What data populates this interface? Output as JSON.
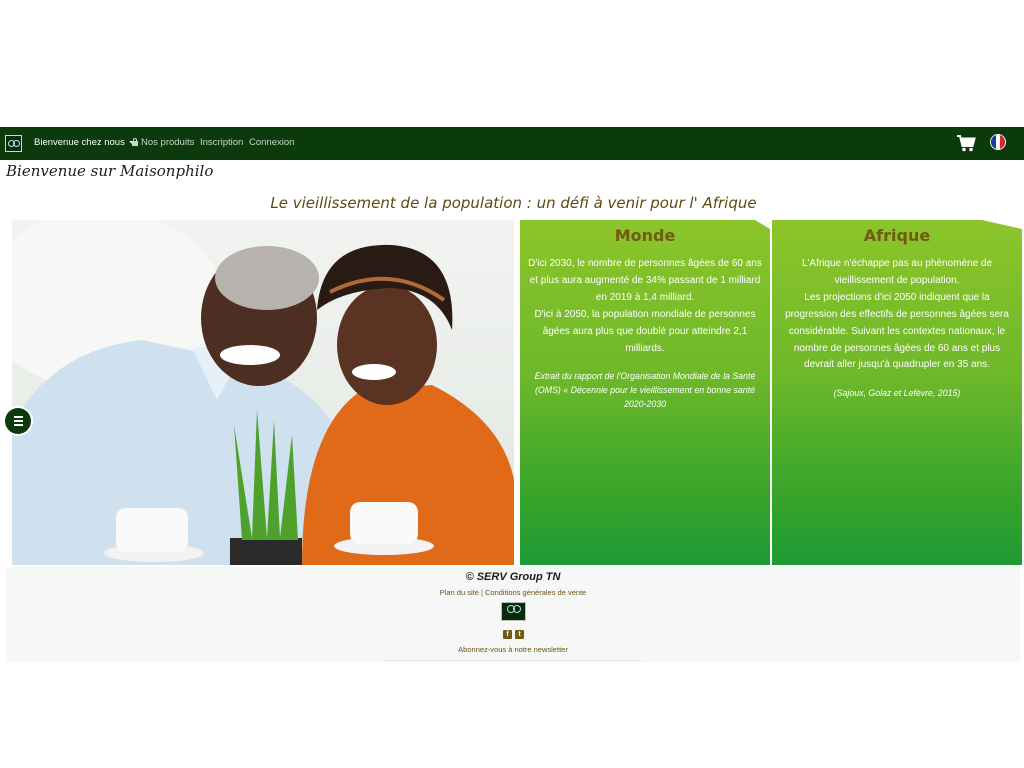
{
  "navbar": {
    "items": [
      {
        "label": "Bienvenue chez nous"
      },
      {
        "label": "Nos produits"
      },
      {
        "label": "Inscription"
      },
      {
        "label": "Connexion"
      }
    ],
    "icons": [
      "logo",
      "lock-icon",
      "cart-icon",
      "flag-fr-icon"
    ],
    "colors": {
      "background": "#0b3a0d",
      "accent": "#735a12"
    }
  },
  "welcome": "Bienvenue sur Maisonphilo",
  "headline": "Le vieillissement de la population : un défi à venir pour l' Afrique",
  "cards": {
    "monde": {
      "title": "Monde",
      "p1": "D'ici 2030, le nombre de personnes âgées de 60 ans et plus aura augmenté de 34% passant de 1 milliard en 2019 à 1,4 milliard.",
      "p2": "D'ici à 2050, la population mondiale de personnes âgées aura plus que doublé pour atteindre 2,1 milliards.",
      "cite": "Extrait du rapport de l'Organisation Mondiale de la Santé (OMS) « Décennie pour le vieillissement en bonne santé 2020-2030"
    },
    "afrique": {
      "title": "Afrique",
      "p1": "L'Afrique n'échappe pas au phénomène de vieillissement de population.",
      "p2": "Les projections d'ici 2050 indiquent que la progression des effectifs de personnes âgées sera considérable. Suivant les contextes nationaux, le nombre de personnes âgées de 60 ans et plus devrait aller jusqu'à quadrupler en 35 ans.",
      "cite": "(Sajoux, Golaz et Lefèvre, 2015)"
    }
  },
  "footer": {
    "copyright": "© SERV Group TN",
    "sitemap": "Plan du site",
    "separator": " | ",
    "terms": "Conditions générales de vente",
    "social": [
      "facebook-icon",
      "twitter-icon"
    ],
    "newsletter": "Abonnez-vous à notre newsletter"
  }
}
